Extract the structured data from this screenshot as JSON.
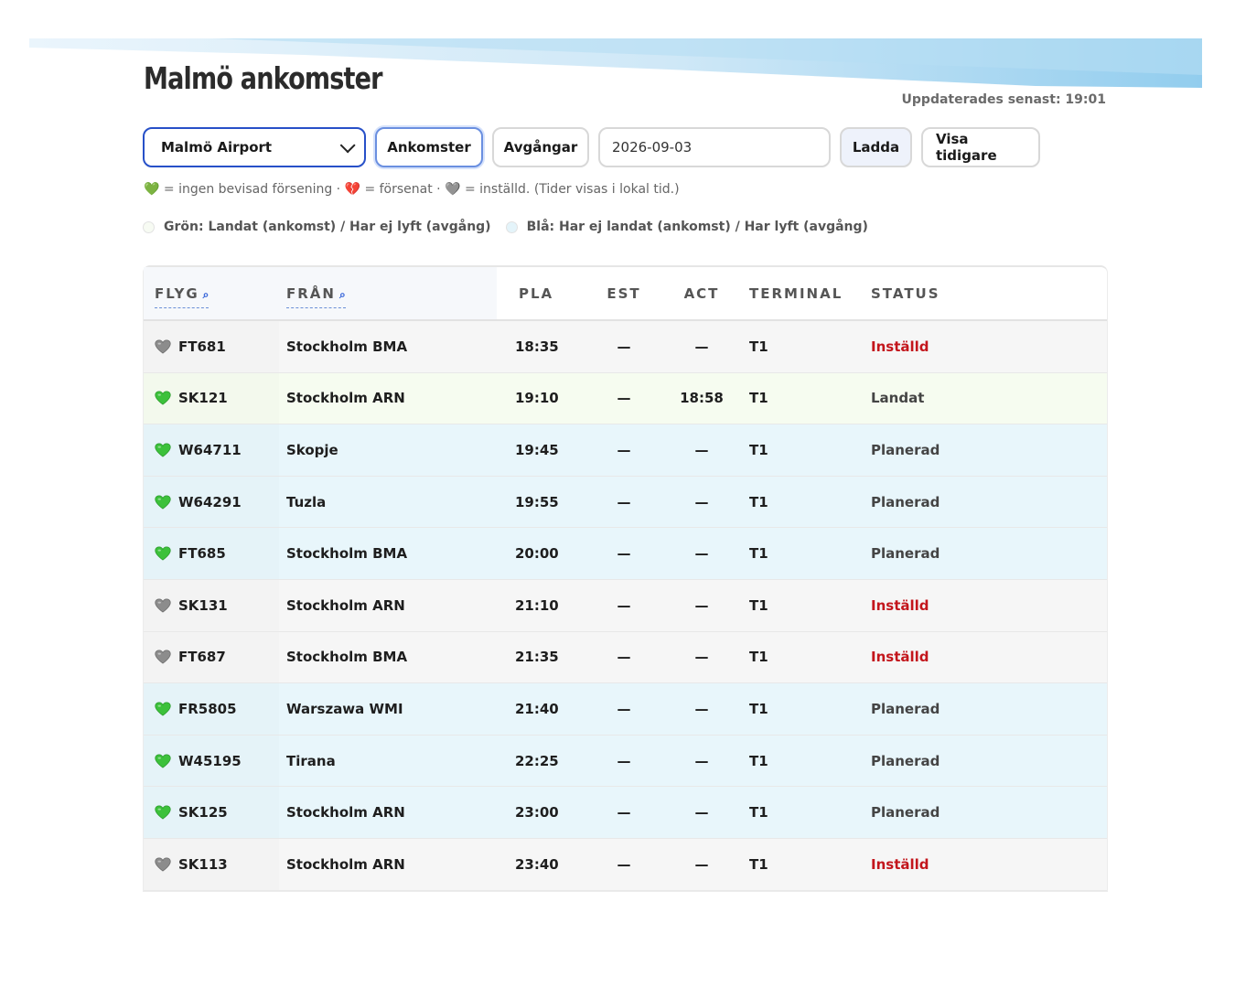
{
  "page": {
    "title": "Malmö ankomster",
    "updated": "Uppdaterades senast: 19:01"
  },
  "toolbar": {
    "airport_selected": "Malmö Airport",
    "arrivals_label": "Ankomster",
    "departures_label": "Avgångar",
    "date_value": "2026-09-03",
    "load_label": "Ladda",
    "show_earlier_label": "Visa tidigare"
  },
  "legend": {
    "hearts": "💚 = ingen bevisad försening · 💔 = försenat · 🩶 = inställd. (Tider visas i lokal tid.)",
    "green_label": "Grön: Landat (ankomst) / Har ej lyft (avgång)",
    "blue_label": "Blå: Har ej landat (ankomst) / Har lyft (avgång)"
  },
  "colors": {
    "accent": "#2750c8",
    "cancelled": "#c3161c",
    "row_green": "#f6fcf0",
    "row_blue": "#e8f6fb",
    "row_gray": "#f6f6f6"
  },
  "table": {
    "headers": {
      "flight": "FLYG",
      "from": "FRÅN",
      "pla": "PLA",
      "est": "EST",
      "act": "ACT",
      "terminal": "TERMINAL",
      "status": "STATUS"
    },
    "rows": [
      {
        "heart": "gray",
        "flight": "FT681",
        "from": "Stockholm BMA",
        "pla": "18:35",
        "est": "—",
        "act": "—",
        "terminal": "T1",
        "status": "Inställd",
        "tone": "gray"
      },
      {
        "heart": "green",
        "flight": "SK121",
        "from": "Stockholm ARN",
        "pla": "19:10",
        "est": "—",
        "act": "18:58",
        "terminal": "T1",
        "status": "Landat",
        "tone": "green"
      },
      {
        "heart": "green",
        "flight": "W64711",
        "from": "Skopje",
        "pla": "19:45",
        "est": "—",
        "act": "—",
        "terminal": "T1",
        "status": "Planerad",
        "tone": "blue"
      },
      {
        "heart": "green",
        "flight": "W64291",
        "from": "Tuzla",
        "pla": "19:55",
        "est": "—",
        "act": "—",
        "terminal": "T1",
        "status": "Planerad",
        "tone": "blue"
      },
      {
        "heart": "green",
        "flight": "FT685",
        "from": "Stockholm BMA",
        "pla": "20:00",
        "est": "—",
        "act": "—",
        "terminal": "T1",
        "status": "Planerad",
        "tone": "blue"
      },
      {
        "heart": "gray",
        "flight": "SK131",
        "from": "Stockholm ARN",
        "pla": "21:10",
        "est": "—",
        "act": "—",
        "terminal": "T1",
        "status": "Inställd",
        "tone": "gray"
      },
      {
        "heart": "gray",
        "flight": "FT687",
        "from": "Stockholm BMA",
        "pla": "21:35",
        "est": "—",
        "act": "—",
        "terminal": "T1",
        "status": "Inställd",
        "tone": "gray"
      },
      {
        "heart": "green",
        "flight": "FR5805",
        "from": "Warszawa WMI",
        "pla": "21:40",
        "est": "—",
        "act": "—",
        "terminal": "T1",
        "status": "Planerad",
        "tone": "blue"
      },
      {
        "heart": "green",
        "flight": "W45195",
        "from": "Tirana",
        "pla": "22:25",
        "est": "—",
        "act": "—",
        "terminal": "T1",
        "status": "Planerad",
        "tone": "blue"
      },
      {
        "heart": "green",
        "flight": "SK125",
        "from": "Stockholm ARN",
        "pla": "23:00",
        "est": "—",
        "act": "—",
        "terminal": "T1",
        "status": "Planerad",
        "tone": "blue"
      },
      {
        "heart": "gray",
        "flight": "SK113",
        "from": "Stockholm ARN",
        "pla": "23:40",
        "est": "—",
        "act": "—",
        "terminal": "T1",
        "status": "Inställd",
        "tone": "gray"
      }
    ]
  }
}
